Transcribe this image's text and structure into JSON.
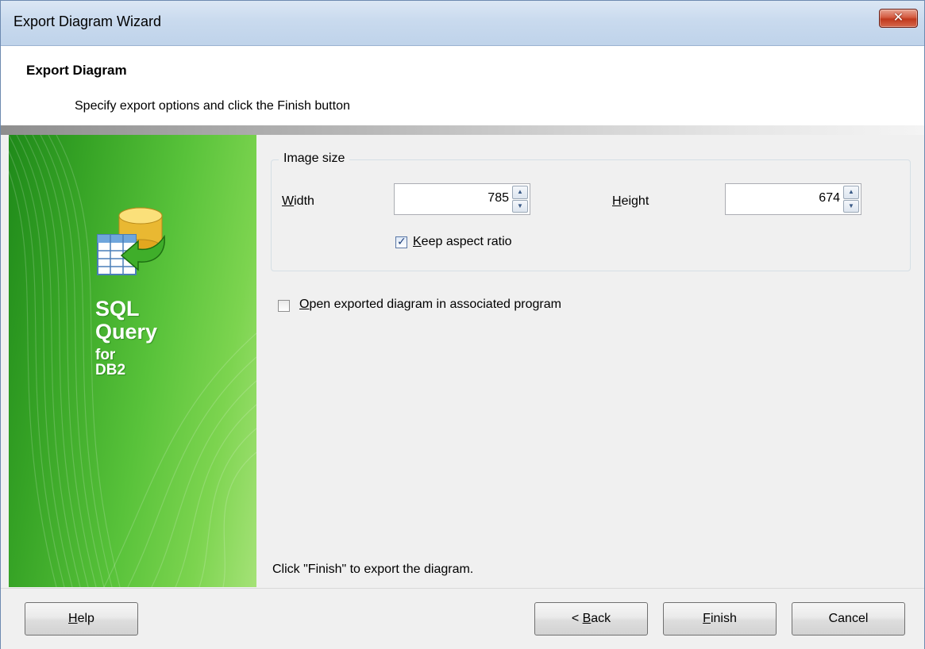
{
  "window": {
    "title": "Export Diagram Wizard",
    "close_glyph": "✕"
  },
  "header": {
    "title": "Export Diagram",
    "subtitle": "Specify export options and click the Finish button"
  },
  "sidebar": {
    "icon": "database-export-icon",
    "brand": [
      "SQL",
      "Query",
      "for",
      "DB2"
    ]
  },
  "image_size": {
    "group_label": "Image size",
    "width_label": "Width",
    "width_value": "785",
    "height_label": "Height",
    "height_value": "674",
    "keep_aspect_label": "Keep aspect ratio",
    "keep_aspect_checked": true
  },
  "open_exported": {
    "label": "Open exported diagram in associated program",
    "checked": false
  },
  "footer_note": "Click \"Finish\" to export the diagram.",
  "buttons": {
    "help": "Help",
    "back": "< Back",
    "finish": "Finish",
    "cancel": "Cancel"
  },
  "colors": {
    "sidebar_green": "#4cb82f",
    "title_bar": "#c9daee",
    "close_red": "#c0391d"
  }
}
